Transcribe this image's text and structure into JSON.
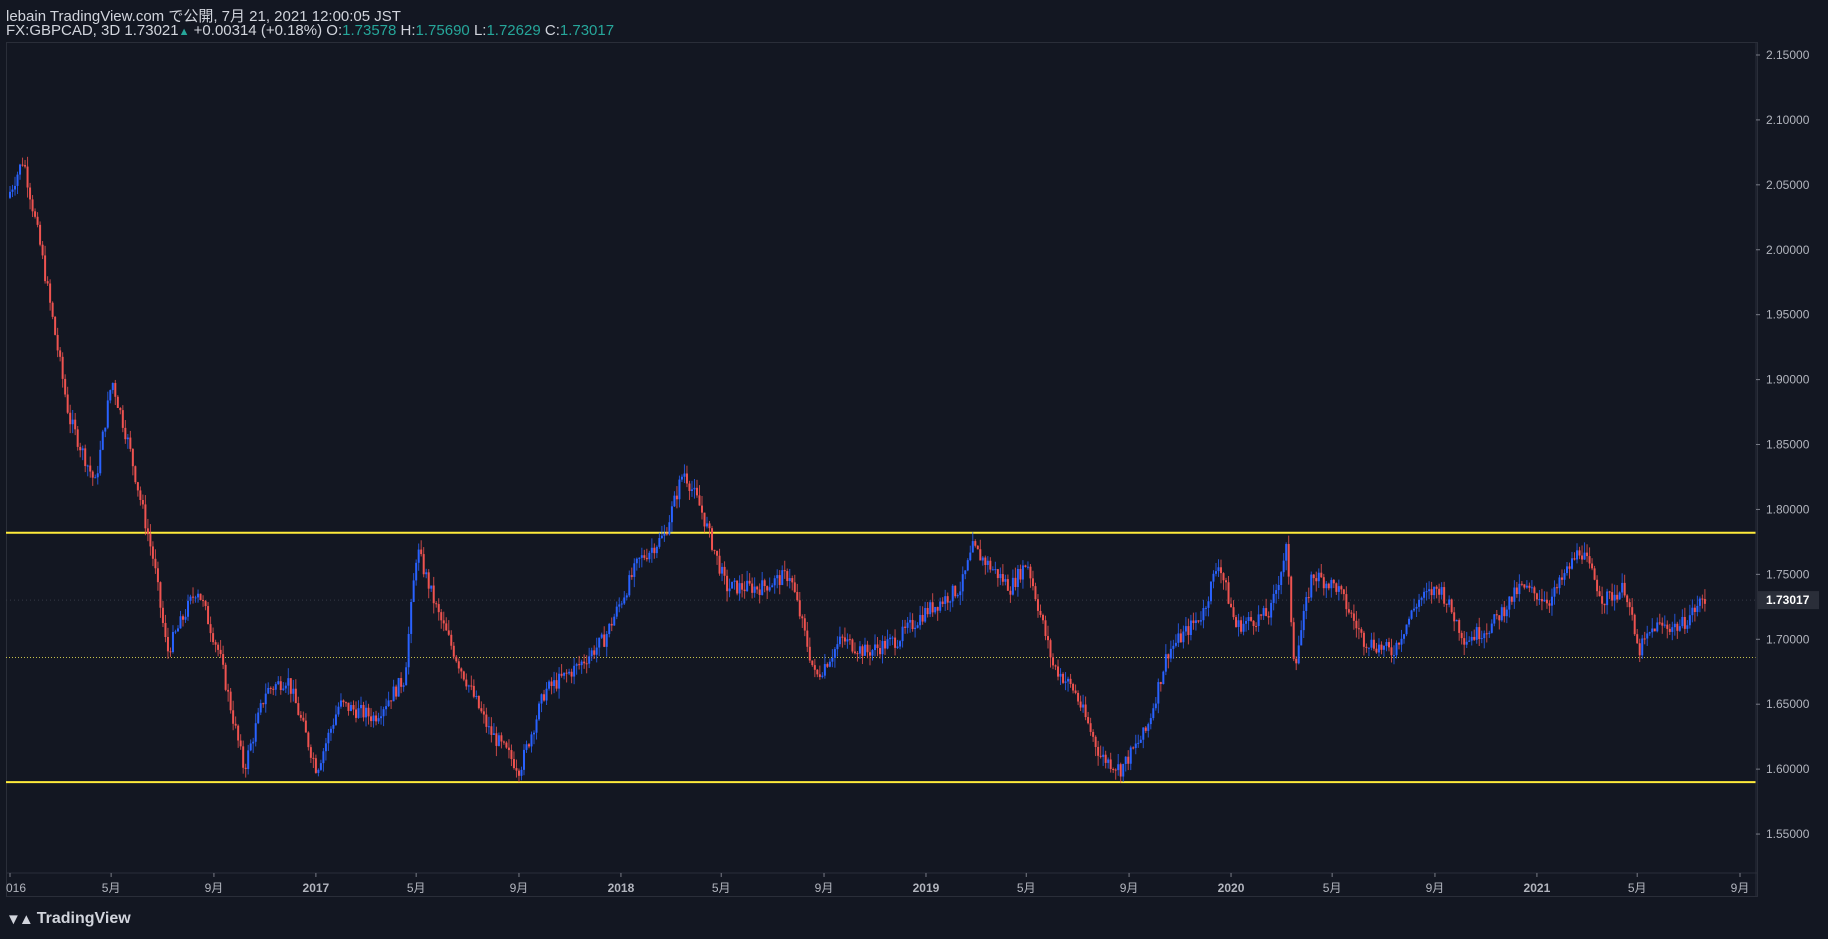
{
  "header": {
    "line1": "lebain TradingView.com で公開, 7月 21, 2021 12:00:05 JST",
    "symbol": "FX:GBPCAD, 3D",
    "last": "1.73021",
    "change": "+0.00314 (+0.18%)",
    "o_label": "O:",
    "o": "1.73578",
    "h_label": "H:",
    "h": "1.75690",
    "l_label": "L:",
    "l": "1.72629",
    "c_label": "C:",
    "c": "1.73017"
  },
  "footer": {
    "logo_text": "TradingView"
  },
  "colors": {
    "background": "#131722",
    "up": "#2962ff",
    "down": "#ef5350",
    "horizontal_lines": "#ffeb3b",
    "text": "#d1d4dc"
  },
  "chart_data": {
    "type": "candlestick",
    "symbol": "FX:GBPCAD",
    "interval": "3D",
    "ylim": [
      1.52,
      2.16
    ],
    "y_ticks": [
      "2.15000",
      "2.10000",
      "2.05000",
      "2.00000",
      "1.95000",
      "1.90000",
      "1.85000",
      "1.80000",
      "1.75000",
      "1.70000",
      "1.65000",
      "1.60000",
      "1.55000"
    ],
    "x_ticks": [
      "016",
      "5月",
      "9月",
      "2017",
      "5月",
      "9月",
      "2018",
      "5月",
      "9月",
      "2019",
      "5月",
      "9月",
      "2020",
      "5月",
      "9月",
      "2021",
      "5月",
      "9月"
    ],
    "x_tick_dates": [
      "2016-01-01",
      "2016-05-01",
      "2016-09-01",
      "2017-01-01",
      "2017-05-01",
      "2017-09-01",
      "2018-01-01",
      "2018-05-01",
      "2018-09-01",
      "2019-01-01",
      "2019-05-01",
      "2019-09-01",
      "2020-01-01",
      "2020-05-01",
      "2020-09-01",
      "2021-01-01",
      "2021-05-01",
      "2021-09-01"
    ],
    "current_price_label": "1.73017",
    "current_price": 1.73017,
    "horizontal_lines": [
      {
        "value": 1.782,
        "style": "solid"
      },
      {
        "value": 1.59,
        "style": "solid"
      },
      {
        "value": 1.686,
        "style": "dotted"
      }
    ],
    "price_path": [
      [
        "2016-01-01",
        2.04
      ],
      [
        "2016-01-20",
        2.07
      ],
      [
        "2016-02-10",
        2.0
      ],
      [
        "2016-03-15",
        1.87
      ],
      [
        "2016-04-15",
        1.82
      ],
      [
        "2016-05-05",
        1.9
      ],
      [
        "2016-05-25",
        1.85
      ],
      [
        "2016-06-24",
        1.76
      ],
      [
        "2016-07-10",
        1.69
      ],
      [
        "2016-08-15",
        1.74
      ],
      [
        "2016-09-10",
        1.69
      ],
      [
        "2016-10-10",
        1.6
      ],
      [
        "2016-11-05",
        1.66
      ],
      [
        "2016-12-01",
        1.67
      ],
      [
        "2017-01-05",
        1.6
      ],
      [
        "2017-02-01",
        1.65
      ],
      [
        "2017-03-15",
        1.64
      ],
      [
        "2017-04-20",
        1.67
      ],
      [
        "2017-05-05",
        1.77
      ],
      [
        "2017-05-30",
        1.72
      ],
      [
        "2017-06-25",
        1.68
      ],
      [
        "2017-07-30",
        1.63
      ],
      [
        "2017-09-05",
        1.6
      ],
      [
        "2017-10-05",
        1.66
      ],
      [
        "2017-11-15",
        1.68
      ],
      [
        "2017-12-15",
        1.7
      ],
      [
        "2018-01-25",
        1.76
      ],
      [
        "2018-02-25",
        1.78
      ],
      [
        "2018-03-20",
        1.83
      ],
      [
        "2018-04-10",
        1.8
      ],
      [
        "2018-05-10",
        1.74
      ],
      [
        "2018-06-20",
        1.74
      ],
      [
        "2018-07-25",
        1.75
      ],
      [
        "2018-08-25",
        1.67
      ],
      [
        "2018-09-25",
        1.7
      ],
      [
        "2018-10-25",
        1.69
      ],
      [
        "2018-12-01",
        1.7
      ],
      [
        "2019-01-01",
        1.72
      ],
      [
        "2019-02-15",
        1.74
      ],
      [
        "2019-03-01",
        1.77
      ],
      [
        "2019-04-15",
        1.74
      ],
      [
        "2019-05-05",
        1.76
      ],
      [
        "2019-06-05",
        1.68
      ],
      [
        "2019-07-01",
        1.66
      ],
      [
        "2019-08-01",
        1.61
      ],
      [
        "2019-08-25",
        1.6
      ],
      [
        "2019-09-25",
        1.63
      ],
      [
        "2019-10-20",
        1.69
      ],
      [
        "2019-12-01",
        1.72
      ],
      [
        "2019-12-20",
        1.76
      ],
      [
        "2020-01-10",
        1.71
      ],
      [
        "2020-02-20",
        1.72
      ],
      [
        "2020-03-10",
        1.77
      ],
      [
        "2020-03-20",
        1.68
      ],
      [
        "2020-04-10",
        1.75
      ],
      [
        "2020-05-10",
        1.74
      ],
      [
        "2020-06-10",
        1.7
      ],
      [
        "2020-07-15",
        1.69
      ],
      [
        "2020-08-15",
        1.73
      ],
      [
        "2020-09-10",
        1.74
      ],
      [
        "2020-10-10",
        1.7
      ],
      [
        "2020-11-10",
        1.71
      ],
      [
        "2020-12-15",
        1.74
      ],
      [
        "2021-01-20",
        1.73
      ],
      [
        "2021-02-25",
        1.77
      ],
      [
        "2021-03-25",
        1.73
      ],
      [
        "2021-04-20",
        1.74
      ],
      [
        "2021-05-05",
        1.69
      ],
      [
        "2021-05-25",
        1.71
      ],
      [
        "2021-06-25",
        1.71
      ],
      [
        "2021-07-21",
        1.73
      ]
    ]
  }
}
